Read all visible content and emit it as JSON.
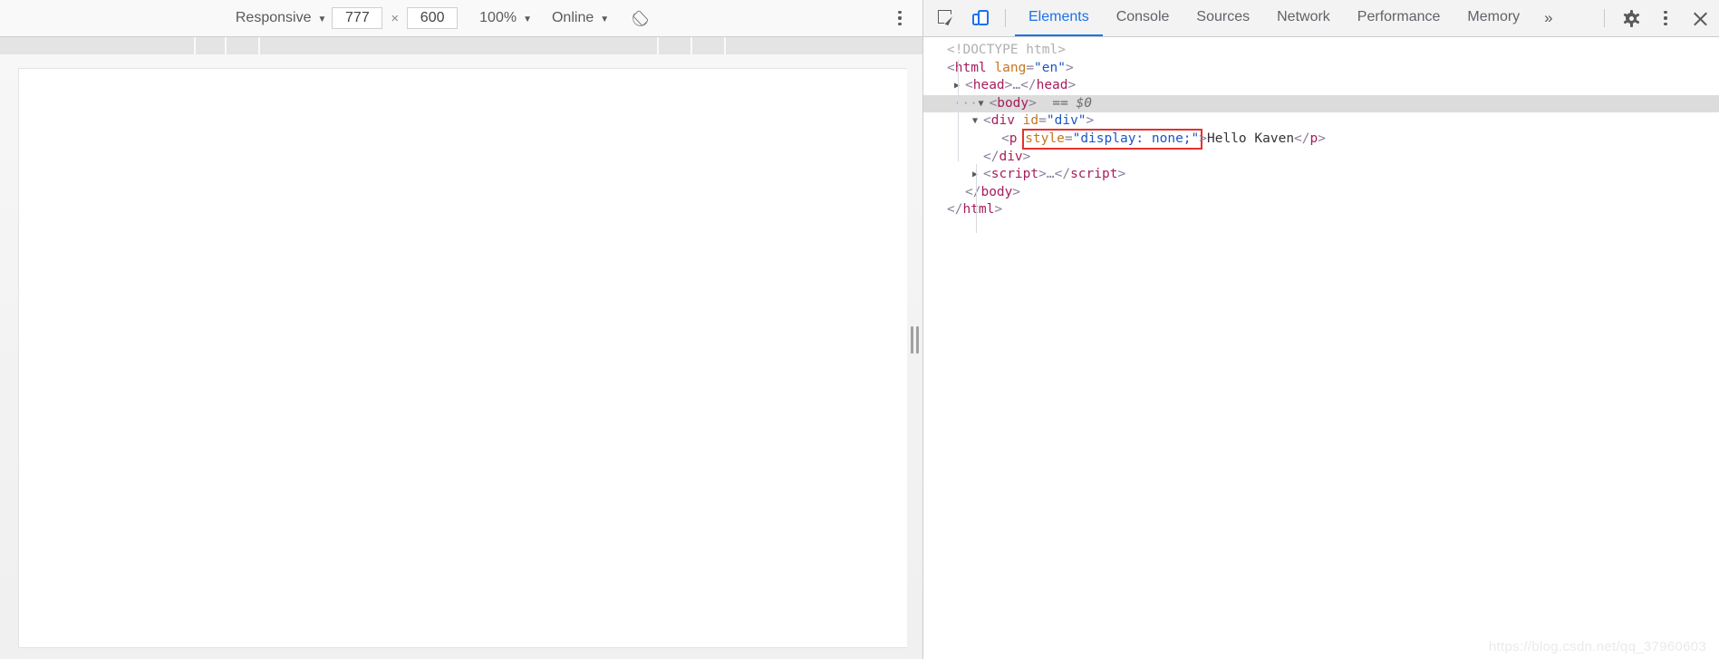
{
  "device_toolbar": {
    "device_label": "Responsive",
    "width_value": "777",
    "height_value": "600",
    "dimension_separator": "×",
    "zoom_label": "100%",
    "throttling_label": "Online",
    "caret": "▼",
    "rotate_icon": "rotate-device-icon",
    "more_options_icon": "kebab-menu-icon"
  },
  "devtools": {
    "inspect_icon": "inspect-element-icon",
    "device_toggle_icon": "toggle-device-toolbar-icon",
    "tabs": [
      {
        "label": "Elements",
        "active": true
      },
      {
        "label": "Console",
        "active": false
      },
      {
        "label": "Sources",
        "active": false
      },
      {
        "label": "Network",
        "active": false
      },
      {
        "label": "Performance",
        "active": false
      },
      {
        "label": "Memory",
        "active": false
      }
    ],
    "overflow_label": "»",
    "settings_icon": "gear-icon",
    "more_icon": "kebab-menu-icon",
    "close_icon": "close-icon"
  },
  "dom_tree": {
    "rows": [
      {
        "id": "doctype",
        "indent": 0,
        "twisty": "",
        "badge": "",
        "selected": false,
        "segments": [
          {
            "cls": "doctype",
            "t": "<!DOCTYPE html>"
          }
        ]
      },
      {
        "id": "html-open",
        "indent": 0,
        "twisty": "",
        "badge": "",
        "selected": false,
        "segments": [
          {
            "cls": "punct",
            "t": "<"
          },
          {
            "cls": "tag",
            "t": "html"
          },
          {
            "cls": "punct",
            "t": " "
          },
          {
            "cls": "attr",
            "t": "lang"
          },
          {
            "cls": "punct",
            "t": "="
          },
          {
            "cls": "val",
            "t": "\"en\""
          },
          {
            "cls": "punct",
            "t": ">"
          }
        ]
      },
      {
        "id": "head",
        "indent": 1,
        "twisty": "▶",
        "badge": "",
        "selected": false,
        "segments": [
          {
            "cls": "punct",
            "t": "<"
          },
          {
            "cls": "tag",
            "t": "head"
          },
          {
            "cls": "punct",
            "t": ">"
          },
          {
            "cls": "punct",
            "t": "…"
          },
          {
            "cls": "punct",
            "t": "</"
          },
          {
            "cls": "tag",
            "t": "head"
          },
          {
            "cls": "punct",
            "t": ">"
          }
        ]
      },
      {
        "id": "body-open",
        "indent": 1,
        "twisty": "▼",
        "badge": "···",
        "selected": true,
        "segments": [
          {
            "cls": "punct",
            "t": "<"
          },
          {
            "cls": "tag",
            "t": "body"
          },
          {
            "cls": "punct",
            "t": ">"
          },
          {
            "cls": "dollar",
            "t": "  == $0"
          }
        ]
      },
      {
        "id": "div-open",
        "indent": 2,
        "twisty": "▼",
        "badge": "",
        "selected": false,
        "segments": [
          {
            "cls": "punct",
            "t": "<"
          },
          {
            "cls": "tag",
            "t": "div"
          },
          {
            "cls": "punct",
            "t": " "
          },
          {
            "cls": "attr",
            "t": "id"
          },
          {
            "cls": "punct",
            "t": "="
          },
          {
            "cls": "val",
            "t": "\"div\""
          },
          {
            "cls": "punct",
            "t": ">"
          }
        ]
      },
      {
        "id": "p-line",
        "indent": 3,
        "twisty": "",
        "badge": "",
        "selected": false,
        "segments": [
          {
            "cls": "punct",
            "t": "<"
          },
          {
            "cls": "tag",
            "t": "p"
          },
          {
            "cls": "punct",
            "t": " "
          },
          {
            "cls": "attr",
            "t": "style"
          },
          {
            "cls": "punct",
            "t": "="
          },
          {
            "cls": "val",
            "t": "\"display: none;\""
          },
          {
            "cls": "punct",
            "t": ">"
          },
          {
            "cls": "txt",
            "t": "Hello Kaven"
          },
          {
            "cls": "punct",
            "t": "</"
          },
          {
            "cls": "tag",
            "t": "p"
          },
          {
            "cls": "punct",
            "t": ">"
          }
        ]
      },
      {
        "id": "div-close",
        "indent": 2,
        "twisty": "",
        "badge": "",
        "selected": false,
        "segments": [
          {
            "cls": "punct",
            "t": "</"
          },
          {
            "cls": "tag",
            "t": "div"
          },
          {
            "cls": "punct",
            "t": ">"
          }
        ]
      },
      {
        "id": "script",
        "indent": 2,
        "twisty": "▶",
        "badge": "",
        "selected": false,
        "segments": [
          {
            "cls": "punct",
            "t": "<"
          },
          {
            "cls": "tag",
            "t": "script"
          },
          {
            "cls": "punct",
            "t": ">"
          },
          {
            "cls": "punct",
            "t": "…"
          },
          {
            "cls": "punct",
            "t": "</"
          },
          {
            "cls": "tag",
            "t": "script"
          },
          {
            "cls": "punct",
            "t": ">"
          }
        ]
      },
      {
        "id": "body-close",
        "indent": 1,
        "twisty": "",
        "badge": "",
        "selected": false,
        "segments": [
          {
            "cls": "punct",
            "t": "</"
          },
          {
            "cls": "tag",
            "t": "body"
          },
          {
            "cls": "punct",
            "t": ">"
          }
        ]
      },
      {
        "id": "html-close",
        "indent": 0,
        "twisty": "",
        "badge": "",
        "selected": false,
        "segments": [
          {
            "cls": "punct",
            "t": "</"
          },
          {
            "cls": "tag",
            "t": "html"
          },
          {
            "cls": "punct",
            "t": ">"
          }
        ]
      }
    ],
    "annotation": {
      "label": "style-attribute-highlight",
      "color": "#e8302a"
    }
  },
  "watermark": {
    "text": "https://blog.csdn.net/qq_37960603"
  },
  "ruler": {
    "tick_positions": [
      214,
      248,
      285,
      725,
      762,
      799
    ]
  },
  "colors": {
    "accent": "#1a73e8",
    "annotation": "#e8302a",
    "tag": "#a71d5d",
    "attribute": "#c5761f",
    "value": "#1a56c4",
    "toolbar_bg": "#f9f9f9",
    "devtools_bg": "#f3f3f3"
  }
}
